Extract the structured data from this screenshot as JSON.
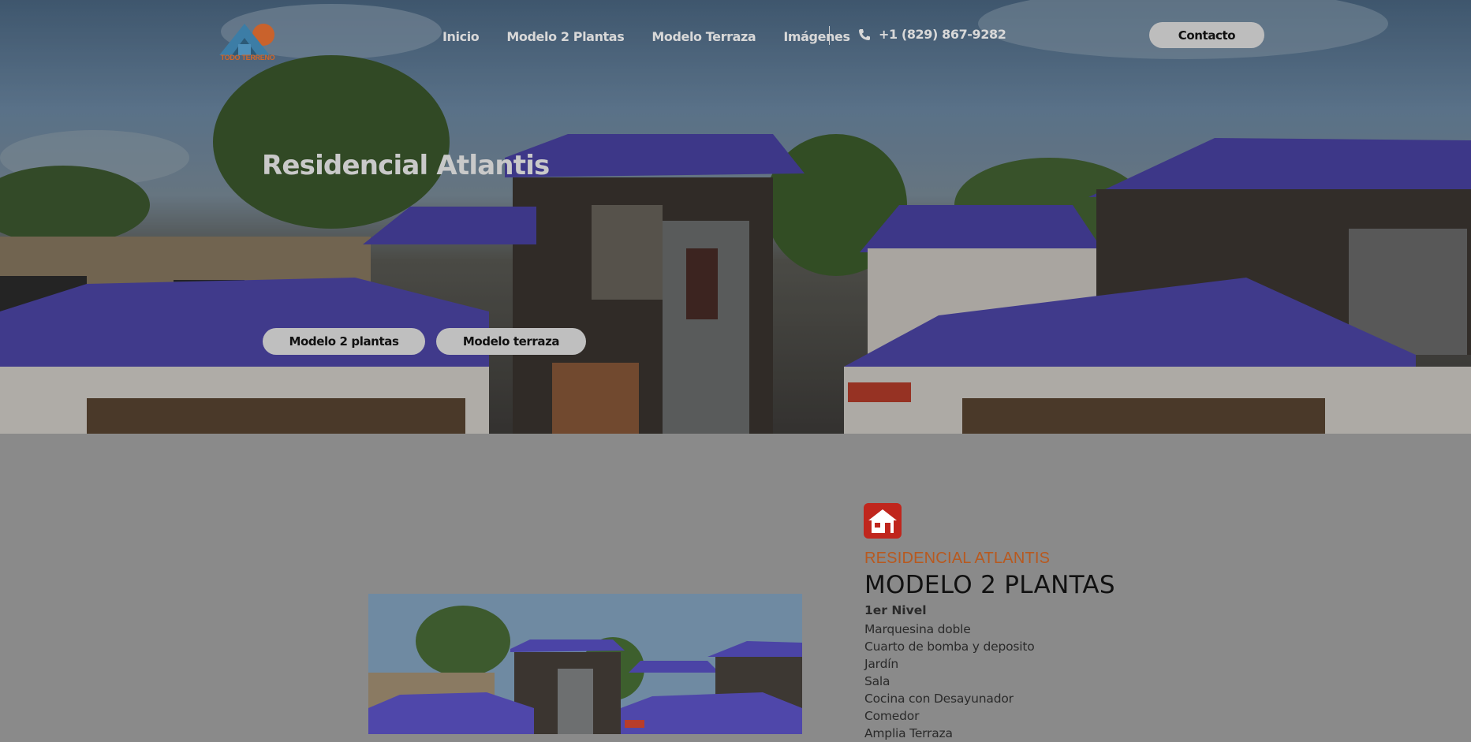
{
  "brand": {
    "logo_text": "TODO TERRENO"
  },
  "nav": {
    "items": [
      {
        "label": "Inicio"
      },
      {
        "label": "Modelo 2 Plantas"
      },
      {
        "label": "Modelo Terraza"
      },
      {
        "label": "Imágenes"
      }
    ],
    "phone": "+1 (829) 867-9282",
    "contact_label": "Contacto"
  },
  "hero": {
    "title": "Residencial Atlantis",
    "buttons": [
      {
        "label": "Modelo 2 plantas"
      },
      {
        "label": "Modelo terraza"
      }
    ]
  },
  "section": {
    "icon": "house-icon",
    "eyebrow": "RESIDENCIAL ATLANTIS",
    "title": "MODELO 2 PLANTAS",
    "level": "1er Nivel",
    "features": [
      "Marquesina doble",
      "Cuarto de bomba y deposito",
      "Jardín",
      "Sala",
      "Cocina con Desayunador",
      "Comedor",
      "Amplia Terraza"
    ]
  },
  "colors": {
    "accent": "#b8591f",
    "icon_red": "#c0261d",
    "roof": "#4b44a6"
  }
}
